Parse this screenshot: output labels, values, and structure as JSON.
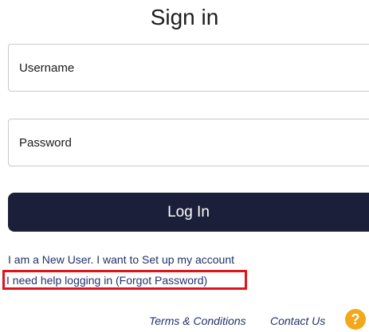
{
  "title": "Sign in",
  "form": {
    "username_placeholder": "Username",
    "username_value": "",
    "password_placeholder": "Password",
    "password_value": "",
    "login_label": "Log In"
  },
  "links": {
    "new_user": "I am a New User. I want to Set up my account",
    "forgot_password": "I need help logging in (Forgot Password)"
  },
  "footer": {
    "terms": "Terms & Conditions",
    "contact": "Contact Us",
    "help_icon": "?"
  },
  "colors": {
    "button_background": "#1b1f3a",
    "link_color": "#23306b",
    "highlight_border": "#e0141b",
    "help_icon_background": "#f2a81d"
  },
  "icons": {
    "help": "help-icon"
  }
}
